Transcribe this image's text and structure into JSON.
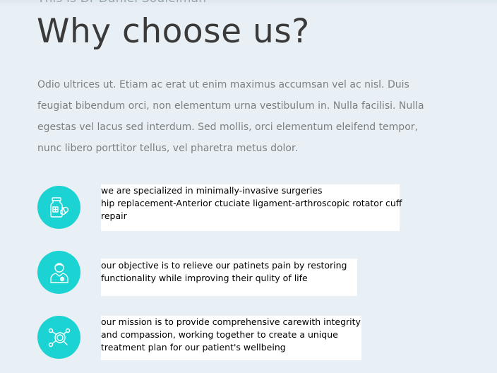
{
  "header": {
    "kicker": "This is Dr Daniel Souleiman",
    "title": "Why choose us?"
  },
  "intro": {
    "text": "Odio ultrices ut. Etiam ac erat ut enim maximus accumsan vel ac nisl. Duis feugiat bibendum orci, non elementum urna vestibulum in. Nulla facilisi. Nulla egestas vel lacus sed interdum. Sed mollis, orci elementum eleifend tempor, nunc libero porttitor tellus, vel pharetra metus dolor."
  },
  "colors": {
    "accent": "#1ad3d2",
    "background": "#e9f0f5",
    "title": "#3a3a3a",
    "body_text": "#7c7f82"
  },
  "features": [
    {
      "icon": "medicine-bottle-icon",
      "lines": [
        "we are specialized in minimally-invasive surgeries",
        "hip replacement-Anterior ctuciate ligament-arthroscopic rotator cuff",
        "repair"
      ]
    },
    {
      "icon": "doctor-icon",
      "lines": [
        "our objective is to relieve our patinets pain by restoring",
        "functionality while improving their qulity of life"
      ]
    },
    {
      "icon": "molecule-magnifier-icon",
      "lines": [
        "our mission is to provide comprehensive carewith integrity",
        "and compassion, working together to create a unique",
        "treatment plan for our patient's wellbeing"
      ]
    }
  ]
}
